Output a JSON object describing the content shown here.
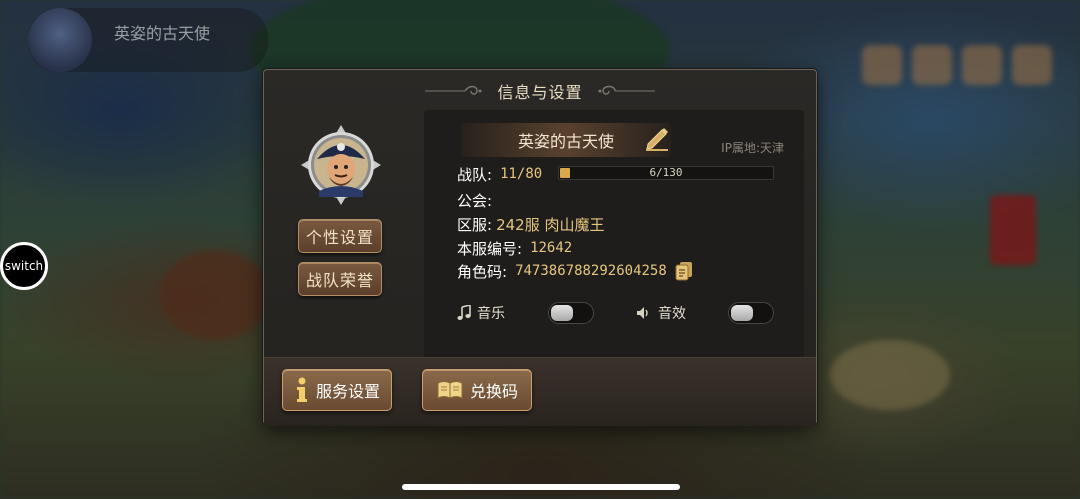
{
  "background": {
    "player_name": "英姿的古天使"
  },
  "overlay": {
    "switch_label": "switch"
  },
  "dialog": {
    "title": "信息与设置",
    "left_buttons": {
      "personal_settings": "个性设置",
      "team_honors": "战队荣誉"
    },
    "profile": {
      "name": "英姿的古天使",
      "ip_location": "IP属地:天津",
      "team_label": "战队:",
      "team_value": "11/80",
      "progress_text": "6/130",
      "progress_fraction": 0.046,
      "guild_label": "公会:",
      "guild_value": "",
      "server_label": "区服:",
      "server_value": "242服 肉山魔王",
      "server_no_label": "本服编号:",
      "server_no_value": "12642",
      "role_code_label": "角色码:",
      "role_code_value": "747386788292604258"
    },
    "toggles": {
      "music_label": "音乐",
      "music_on": false,
      "sfx_label": "音效",
      "sfx_on": false
    },
    "bottom_buttons": {
      "service_settings": "服务设置",
      "redeem_code": "兑换码"
    }
  },
  "colors": {
    "accent_gold": "#e5c67e",
    "button_brown": "#6a4b32",
    "panel_bg": "#24221f"
  }
}
